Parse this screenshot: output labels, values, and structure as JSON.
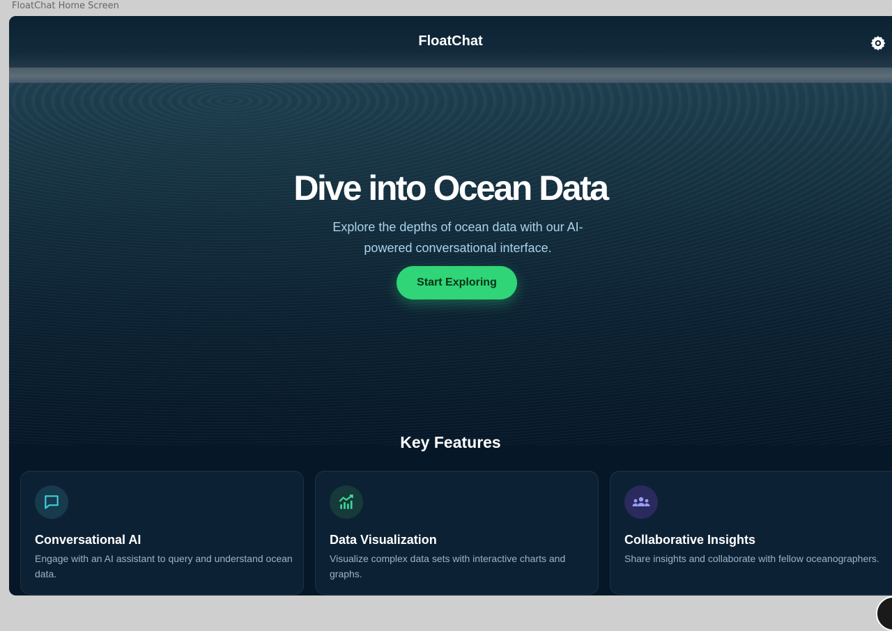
{
  "window": {
    "label": "FloatChat Home Screen"
  },
  "header": {
    "title": "FloatChat",
    "settings_icon": "gear-icon"
  },
  "hero": {
    "title": "Dive into Ocean Data",
    "subtitle": "Explore the depths of ocean data with our AI-powered conversational interface.",
    "cta_label": "Start Exploring"
  },
  "features": {
    "heading": "Key Features",
    "items": [
      {
        "icon": "chat-bubble-icon",
        "title": "Conversational AI",
        "description": "Engage with an AI assistant to query and understand ocean data."
      },
      {
        "icon": "chart-icon",
        "title": "Data Visualization",
        "description": "Visualize complex data sets with interactive charts and graphs."
      },
      {
        "icon": "group-icon",
        "title": "Collaborative Insights",
        "description": "Share insights and collaborate with fellow oceanographers."
      }
    ]
  },
  "colors": {
    "accent": "#2fd576",
    "background": "#061727",
    "card": "#0d2134",
    "subtitle_text": "#a9d3ec"
  }
}
